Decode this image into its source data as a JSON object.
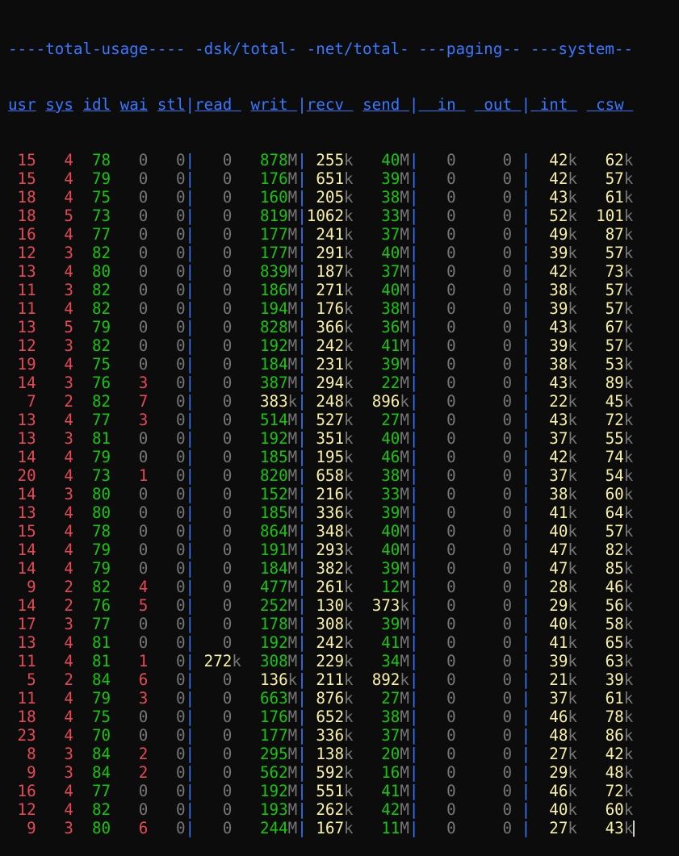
{
  "colors": {
    "background": "#0c0c0c",
    "section": "#3b78ff",
    "separator": "#3b78ff",
    "red": "#e74856",
    "green": "#16c60c",
    "yellow": "#f9f1a5",
    "gray": "#767676",
    "cursor": "#cccccc"
  },
  "group_header": "----total-usage---- -dsk/total- -net/total- ---paging-- ---system--",
  "columns": [
    {
      "label": "usr",
      "width": 3
    },
    {
      "label": "sys",
      "width": 3
    },
    {
      "label": "idl",
      "width": 3
    },
    {
      "label": "wai",
      "width": 3
    },
    {
      "label": "stl",
      "width": 3
    },
    {
      "label": "read",
      "width": 5
    },
    {
      "label": "writ",
      "width": 5
    },
    {
      "label": "recv",
      "width": 5
    },
    {
      "label": "send",
      "width": 5
    },
    {
      "label": "in",
      "width": 5
    },
    {
      "label": "out",
      "width": 5
    },
    {
      "label": "int",
      "width": 5
    },
    {
      "label": "csw",
      "width": 5
    }
  ],
  "groups": [
    [
      0,
      1,
      2,
      3,
      4
    ],
    [
      5,
      6
    ],
    [
      7,
      8
    ],
    [
      9,
      10
    ],
    [
      11,
      12
    ]
  ],
  "rows": [
    [
      "15",
      "4",
      "78",
      "0",
      "0",
      "0",
      "878M",
      "255k",
      "40M",
      "0",
      "0",
      "42k",
      "62k"
    ],
    [
      "15",
      "4",
      "79",
      "0",
      "0",
      "0",
      "176M",
      "651k",
      "39M",
      "0",
      "0",
      "42k",
      "57k"
    ],
    [
      "18",
      "4",
      "75",
      "0",
      "0",
      "0",
      "160M",
      "205k",
      "38M",
      "0",
      "0",
      "43k",
      "61k"
    ],
    [
      "18",
      "5",
      "73",
      "0",
      "0",
      "0",
      "819M",
      "1062k",
      "33M",
      "0",
      "0",
      "52k",
      "101k"
    ],
    [
      "16",
      "4",
      "77",
      "0",
      "0",
      "0",
      "177M",
      "241k",
      "37M",
      "0",
      "0",
      "49k",
      "87k"
    ],
    [
      "12",
      "3",
      "82",
      "0",
      "0",
      "0",
      "177M",
      "291k",
      "40M",
      "0",
      "0",
      "39k",
      "57k"
    ],
    [
      "13",
      "4",
      "80",
      "0",
      "0",
      "0",
      "839M",
      "187k",
      "37M",
      "0",
      "0",
      "42k",
      "73k"
    ],
    [
      "11",
      "3",
      "82",
      "0",
      "0",
      "0",
      "186M",
      "271k",
      "40M",
      "0",
      "0",
      "38k",
      "57k"
    ],
    [
      "11",
      "4",
      "82",
      "0",
      "0",
      "0",
      "194M",
      "176k",
      "38M",
      "0",
      "0",
      "39k",
      "57k"
    ],
    [
      "13",
      "5",
      "79",
      "0",
      "0",
      "0",
      "828M",
      "366k",
      "36M",
      "0",
      "0",
      "43k",
      "67k"
    ],
    [
      "12",
      "3",
      "82",
      "0",
      "0",
      "0",
      "192M",
      "242k",
      "41M",
      "0",
      "0",
      "39k",
      "57k"
    ],
    [
      "19",
      "4",
      "75",
      "0",
      "0",
      "0",
      "184M",
      "231k",
      "39M",
      "0",
      "0",
      "38k",
      "53k"
    ],
    [
      "14",
      "3",
      "76",
      "3",
      "0",
      "0",
      "387M",
      "294k",
      "22M",
      "0",
      "0",
      "43k",
      "89k"
    ],
    [
      "7",
      "2",
      "82",
      "7",
      "0",
      "0",
      "383k",
      "248k",
      "896k",
      "0",
      "0",
      "22k",
      "45k"
    ],
    [
      "13",
      "4",
      "77",
      "3",
      "0",
      "0",
      "514M",
      "527k",
      "27M",
      "0",
      "0",
      "43k",
      "72k"
    ],
    [
      "13",
      "3",
      "81",
      "0",
      "0",
      "0",
      "192M",
      "351k",
      "40M",
      "0",
      "0",
      "37k",
      "55k"
    ],
    [
      "14",
      "4",
      "79",
      "0",
      "0",
      "0",
      "185M",
      "195k",
      "46M",
      "0",
      "0",
      "42k",
      "74k"
    ],
    [
      "20",
      "4",
      "73",
      "1",
      "0",
      "0",
      "820M",
      "658k",
      "38M",
      "0",
      "0",
      "37k",
      "54k"
    ],
    [
      "14",
      "3",
      "80",
      "0",
      "0",
      "0",
      "152M",
      "216k",
      "33M",
      "0",
      "0",
      "38k",
      "60k"
    ],
    [
      "13",
      "4",
      "80",
      "0",
      "0",
      "0",
      "185M",
      "336k",
      "39M",
      "0",
      "0",
      "41k",
      "64k"
    ],
    [
      "15",
      "4",
      "78",
      "0",
      "0",
      "0",
      "864M",
      "348k",
      "40M",
      "0",
      "0",
      "40k",
      "57k"
    ],
    [
      "14",
      "4",
      "79",
      "0",
      "0",
      "0",
      "191M",
      "293k",
      "40M",
      "0",
      "0",
      "47k",
      "82k"
    ],
    [
      "14",
      "4",
      "79",
      "0",
      "0",
      "0",
      "184M",
      "382k",
      "39M",
      "0",
      "0",
      "47k",
      "85k"
    ],
    [
      "9",
      "2",
      "82",
      "4",
      "0",
      "0",
      "477M",
      "261k",
      "12M",
      "0",
      "0",
      "28k",
      "46k"
    ],
    [
      "14",
      "2",
      "76",
      "5",
      "0",
      "0",
      "252M",
      "130k",
      "373k",
      "0",
      "0",
      "29k",
      "56k"
    ],
    [
      "17",
      "3",
      "77",
      "0",
      "0",
      "0",
      "178M",
      "308k",
      "39M",
      "0",
      "0",
      "40k",
      "58k"
    ],
    [
      "13",
      "4",
      "81",
      "0",
      "0",
      "0",
      "192M",
      "242k",
      "41M",
      "0",
      "0",
      "41k",
      "65k"
    ],
    [
      "11",
      "4",
      "81",
      "1",
      "0",
      "272k",
      "308M",
      "229k",
      "34M",
      "0",
      "0",
      "39k",
      "63k"
    ],
    [
      "5",
      "2",
      "84",
      "6",
      "0",
      "0",
      "136k",
      "211k",
      "892k",
      "0",
      "0",
      "21k",
      "39k"
    ],
    [
      "11",
      "4",
      "79",
      "3",
      "0",
      "0",
      "663M",
      "876k",
      "27M",
      "0",
      "0",
      "37k",
      "61k"
    ],
    [
      "18",
      "4",
      "75",
      "0",
      "0",
      "0",
      "176M",
      "652k",
      "38M",
      "0",
      "0",
      "46k",
      "78k"
    ],
    [
      "23",
      "4",
      "70",
      "0",
      "0",
      "0",
      "177M",
      "336k",
      "37M",
      "0",
      "0",
      "48k",
      "86k"
    ],
    [
      "8",
      "3",
      "84",
      "2",
      "0",
      "0",
      "295M",
      "138k",
      "20M",
      "0",
      "0",
      "27k",
      "42k"
    ],
    [
      "9",
      "3",
      "84",
      "2",
      "0",
      "0",
      "562M",
      "592k",
      "16M",
      "0",
      "0",
      "29k",
      "48k"
    ],
    [
      "16",
      "4",
      "77",
      "0",
      "0",
      "0",
      "192M",
      "551k",
      "41M",
      "0",
      "0",
      "46k",
      "72k"
    ],
    [
      "12",
      "4",
      "82",
      "0",
      "0",
      "0",
      "193M",
      "262k",
      "42M",
      "0",
      "0",
      "40k",
      "60k"
    ],
    [
      "9",
      "3",
      "80",
      "6",
      "0",
      "0",
      "244M",
      "167k",
      "11M",
      "0",
      "0",
      "27k",
      "43k"
    ]
  ]
}
